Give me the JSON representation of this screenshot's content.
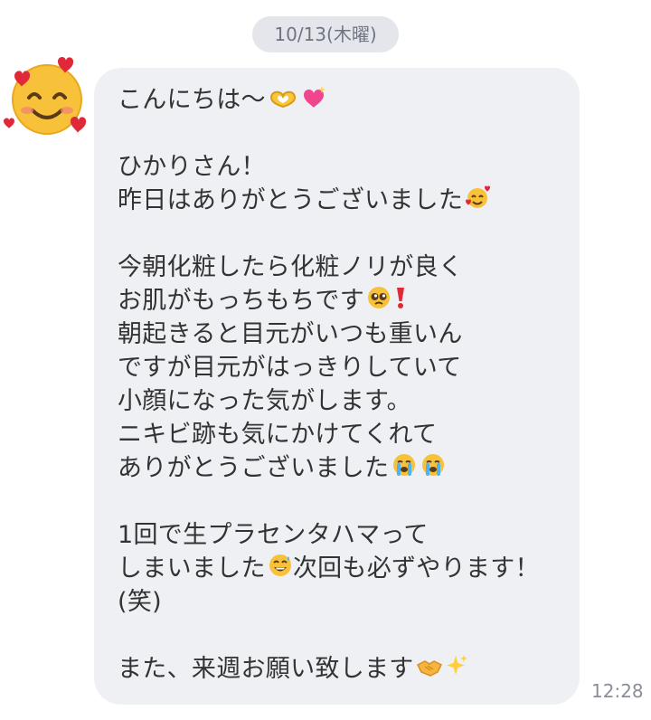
{
  "chat": {
    "date_label": "10/13(木曜)",
    "time": "12:28",
    "avatar_icon": "smiling-face-with-hearts-icon",
    "message_lines": [
      "こんにちは〜",
      "",
      "ひかりさん！",
      "昨日はありがとうございました",
      "",
      "今朝化粧したら化粧ノリが良く",
      "お肌がもっちもちです",
      "朝起きると目元がいつも重いん",
      "ですが目元がはっきりしていて",
      "小顔になった気がします。",
      "ニキビ跡も気にかけてくれて",
      "ありがとうございました",
      "",
      "1回で生プラセンタハマって",
      "しまいました",
      "(笑)",
      "",
      "また、来週お願い致します"
    ],
    "line14_suffix": "次回も必ずやります！"
  }
}
